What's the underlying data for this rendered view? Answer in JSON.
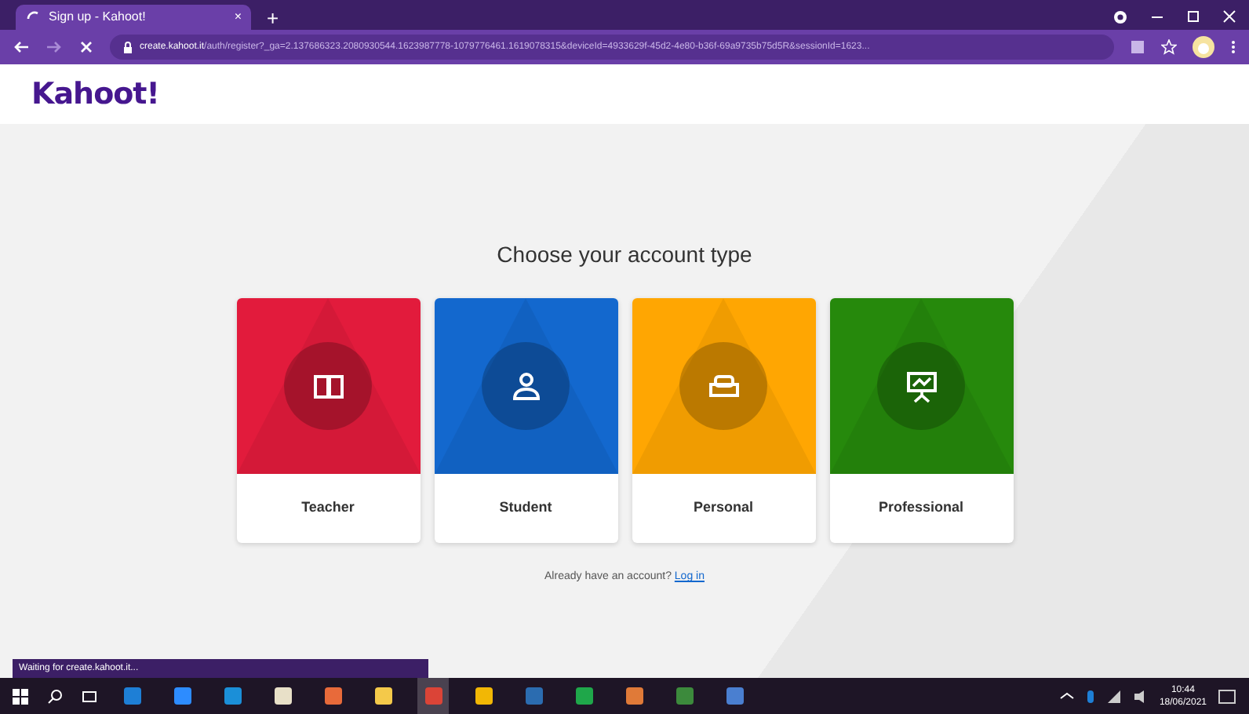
{
  "browser": {
    "tab_title": "Sign up - Kahoot!",
    "tab_close": "×",
    "new_tab": "+",
    "url_host": "create.kahoot.it",
    "url_rest": "/auth/register?_ga=2.137686323.2080930544.1623987778-1079776461.1619078315&deviceId=4933629f-45d2-4e80-b36f-69a9735b75d5R&sessionId=1623..."
  },
  "header": {
    "logo": "Kahoot!"
  },
  "heading": "Choose your account type",
  "cards": [
    {
      "label": "Teacher",
      "color": "#e21b3c",
      "kind": "book"
    },
    {
      "label": "Student",
      "color": "#1368ce",
      "kind": "person"
    },
    {
      "label": "Personal",
      "color": "#ffa602",
      "kind": "sofa"
    },
    {
      "label": "Professional",
      "color": "#26890c",
      "kind": "presentation"
    }
  ],
  "login": {
    "prompt": "Already have an account?",
    "link": "Log in"
  },
  "status_text": "Waiting for create.kahoot.it...",
  "taskbar": {
    "apps": [
      {
        "color": "#1e7fd6",
        "selected": false
      },
      {
        "color": "#2d8cff",
        "selected": false
      },
      {
        "color": "#1b8fd8",
        "selected": false
      },
      {
        "color": "#e8e0c8",
        "selected": false
      },
      {
        "color": "#e86a3a",
        "selected": false
      },
      {
        "color": "#f4c94a",
        "selected": false
      },
      {
        "color": "#db4437",
        "selected": true
      },
      {
        "color": "#f2b705",
        "selected": false
      },
      {
        "color": "#2b6cb0",
        "selected": false
      },
      {
        "color": "#1fa74a",
        "selected": false
      },
      {
        "color": "#e07a38",
        "selected": false
      },
      {
        "color": "#3c8a3c",
        "selected": false
      },
      {
        "color": "#4a7fd0",
        "selected": false
      }
    ],
    "time": "10:44",
    "date": "18/06/2021"
  }
}
